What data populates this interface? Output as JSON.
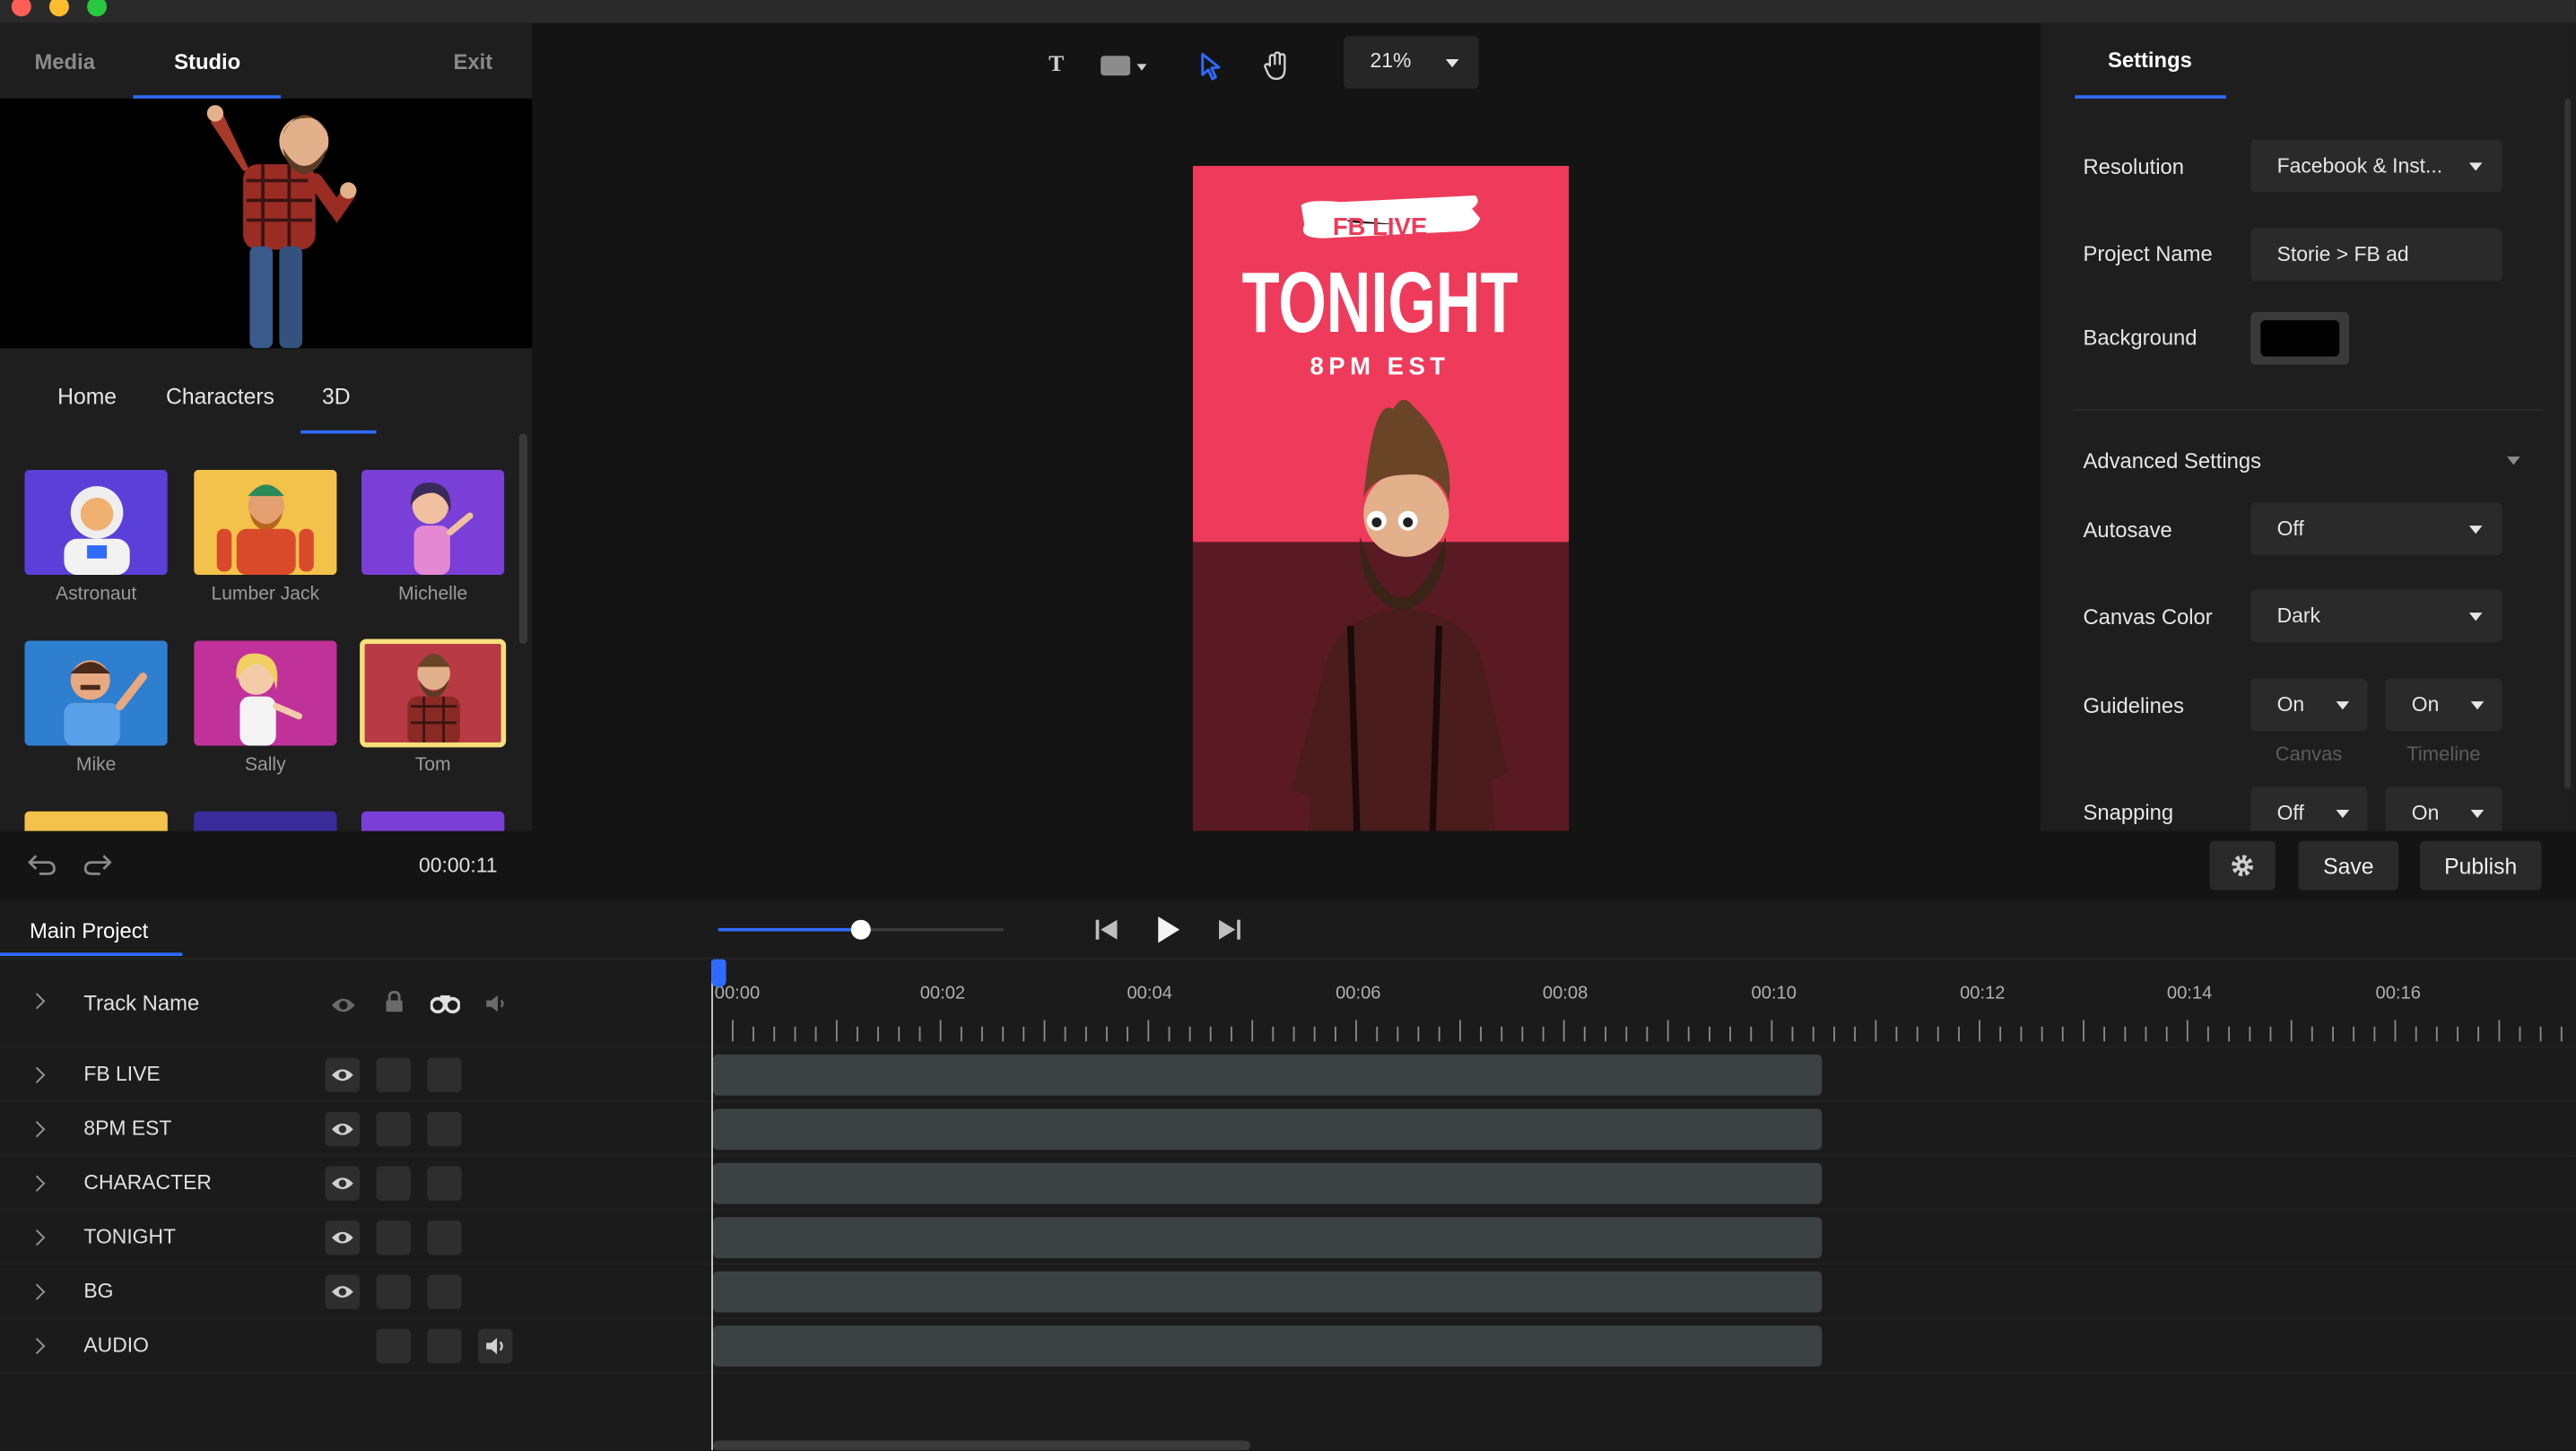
{
  "top_tabs": {
    "media": "Media",
    "studio": "Studio",
    "exit": "Exit"
  },
  "sub_tabs": {
    "home": "Home",
    "characters": "Characters",
    "three_d": "3D"
  },
  "characters": [
    {
      "label": "Astronaut",
      "bg": "#5a3fd8"
    },
    {
      "label": "Lumber Jack",
      "bg": "#f2c24a"
    },
    {
      "label": "Michelle",
      "bg": "#7a3fd6"
    },
    {
      "label": "Mike",
      "bg": "#2f7fd0"
    },
    {
      "label": "Sally",
      "bg": "#c0329a"
    },
    {
      "label": "Tom",
      "bg": "#b83a44"
    }
  ],
  "toolbar": {
    "zoom": "21%"
  },
  "artboard": {
    "banner": "FB LIVE",
    "headline": "TONIGHT",
    "subline": "8PM EST",
    "top_color": "#ee3b5b",
    "bottom_color": "#5a1a24"
  },
  "settings": {
    "title": "Settings",
    "resolution_label": "Resolution",
    "resolution_value": "Facebook & Inst...",
    "project_name_label": "Project Name",
    "project_name_value": "Storie > FB ad",
    "background_label": "Background",
    "background_color": "#000000",
    "advanced_label": "Advanced Settings",
    "autosave_label": "Autosave",
    "autosave_value": "Off",
    "canvas_color_label": "Canvas Color",
    "canvas_color_value": "Dark",
    "guidelines_label": "Guidelines",
    "guidelines_canvas": "On",
    "guidelines_timeline": "On",
    "canvas_caption": "Canvas",
    "timeline_caption": "Timeline",
    "snapping_label": "Snapping",
    "snapping_canvas": "Off",
    "snapping_timeline": "On"
  },
  "strip": {
    "time": "00:00:11",
    "save": "Save",
    "publish": "Publish"
  },
  "timeline": {
    "tab": "Main Project",
    "header_label": "Track Name",
    "tracks": [
      "FB LIVE",
      "8PM EST",
      "CHARACTER",
      "TONIGHT",
      "BG",
      "AUDIO"
    ],
    "ticks": [
      "00:00",
      "00:02",
      "00:04",
      "00:06",
      "00:08",
      "00:10",
      "00:12",
      "00:14",
      "00:16"
    ],
    "scrubber_progress": 0.5
  },
  "colors": {
    "accent": "#2f6bff",
    "panel": "#1e1e1e",
    "bg": "#141414"
  }
}
